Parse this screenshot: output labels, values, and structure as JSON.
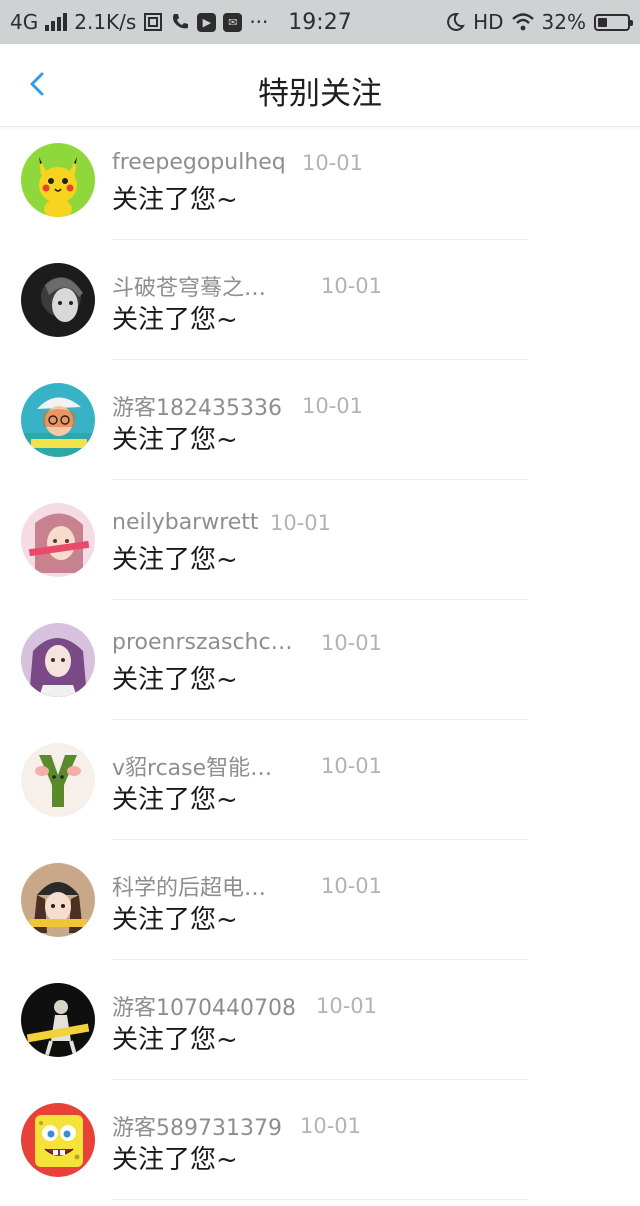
{
  "status_bar": {
    "network": "4G",
    "speed": "2.1K/s",
    "time": "19:27",
    "hd": "HD",
    "battery": "32%",
    "battery_level": 0.32
  },
  "nav": {
    "title": "特别关注",
    "back_icon": "chevron-left-icon",
    "accent": "#2f9fe6"
  },
  "items": [
    {
      "name": "freepegopulheq",
      "date": "10-01",
      "message": "关注了您~",
      "avatar": "pikachu-avatar"
    },
    {
      "name": "斗破苍穹蓦之…",
      "date": "10-01",
      "message": "关注了您~",
      "avatar": "dark-portrait-avatar"
    },
    {
      "name": "游客182435336",
      "date": "10-01",
      "message": "关注了您~",
      "avatar": "girl-hat-avatar"
    },
    {
      "name": "neilybarwrett",
      "date": "10-01",
      "message": "关注了您~",
      "avatar": "pink-girl-avatar"
    },
    {
      "name": "proenrszaschc…",
      "date": "10-01",
      "message": "关注了您~",
      "avatar": "purple-hair-avatar"
    },
    {
      "name": "v貂rcase智能…",
      "date": "10-01",
      "message": "关注了您~",
      "avatar": "green-y-avatar"
    },
    {
      "name": "科学的后超电…",
      "date": "10-01",
      "message": "关注了您~",
      "avatar": "beanie-girl-avatar"
    },
    {
      "name": "游客1070440708",
      "date": "10-01",
      "message": "关注了您~",
      "avatar": "night-figure-avatar"
    },
    {
      "name": "游客589731379",
      "date": "10-01",
      "message": "关注了您~",
      "avatar": "spongebob-avatar"
    }
  ]
}
